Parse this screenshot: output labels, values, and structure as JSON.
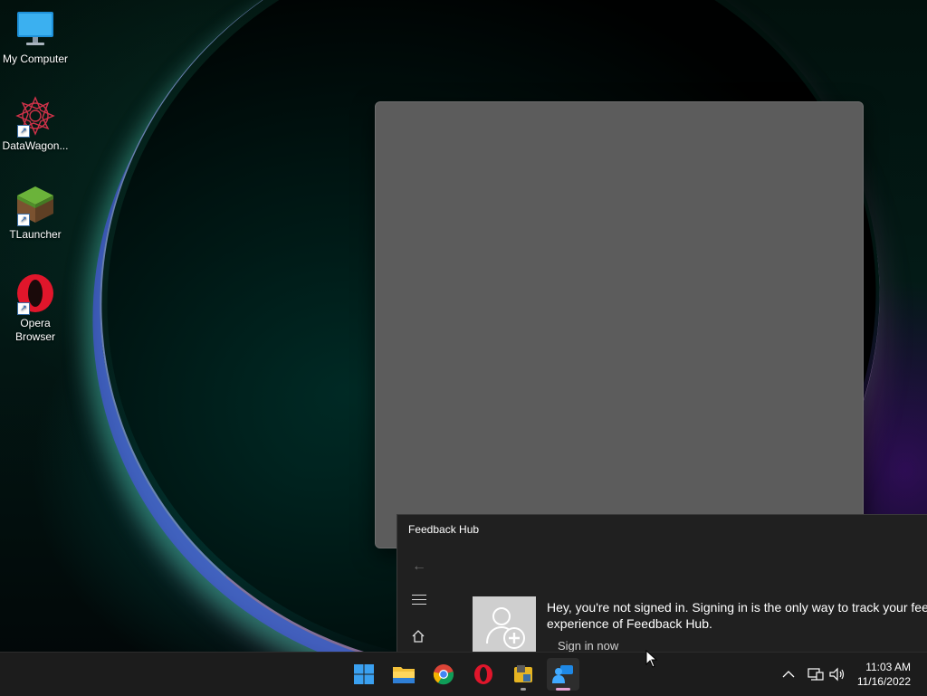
{
  "desktop": {
    "icons": [
      {
        "label": "My Computer",
        "icon": "monitor-icon"
      },
      {
        "label": "DataWagon...",
        "icon": "datawagon-icon",
        "shortcut": true
      },
      {
        "label": "TLauncher",
        "icon": "minecraft-grass-block-icon",
        "shortcut": true
      },
      {
        "label": "Opera Browser",
        "icon": "opera-icon",
        "shortcut": true
      }
    ]
  },
  "feedback_hub": {
    "title": "Feedback Hub",
    "message": "Hey, you're not signed in. Signing in is the only way to track your feedback and get the full experience of Feedback Hub.",
    "message_line1": "Hey, you're not signed in. Signing in is the only way to track your fee",
    "message_line2": "experience of Feedback Hub.",
    "signin_label": "Sign in now"
  },
  "taskbar": {
    "apps": [
      {
        "name": "start",
        "icon": "windows-start-icon"
      },
      {
        "name": "file-explorer",
        "icon": "folder-icon"
      },
      {
        "name": "chrome",
        "icon": "chrome-icon"
      },
      {
        "name": "opera",
        "icon": "opera-icon"
      },
      {
        "name": "app",
        "icon": "app-icon"
      },
      {
        "name": "feedback-hub",
        "icon": "feedback-hub-icon",
        "active": true
      }
    ],
    "clock": {
      "time": "11:03 AM",
      "date": "11/16/2022"
    }
  },
  "colors": {
    "accent": "#0078d4",
    "window_gray": "#5c5c5c",
    "app_bg": "#202020",
    "taskbar": "#1c1c1c"
  }
}
